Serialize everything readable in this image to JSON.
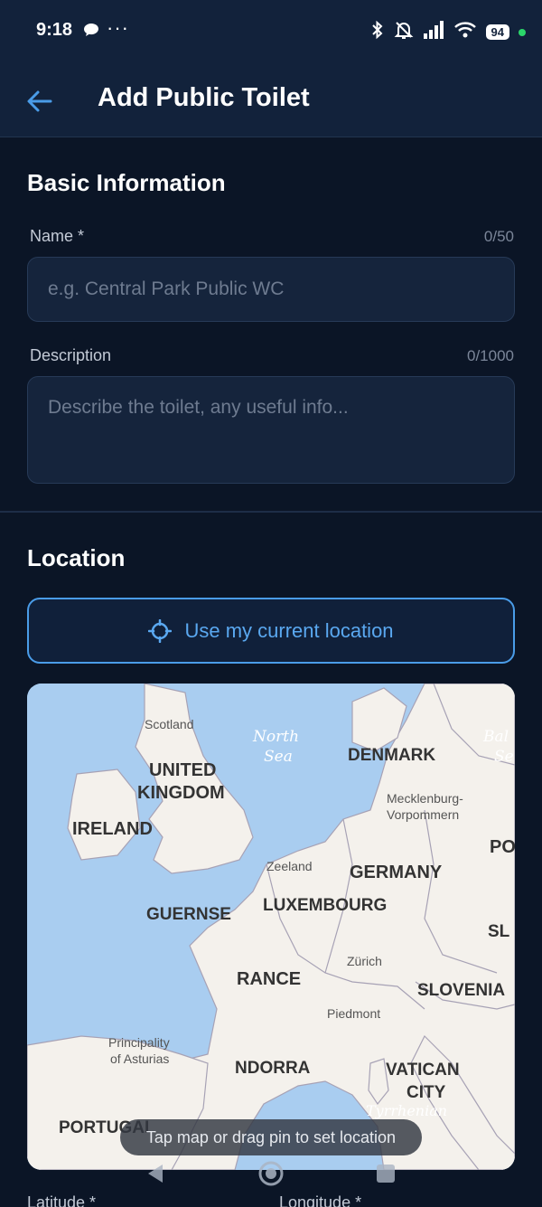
{
  "status": {
    "time": "9:18",
    "dots": "···",
    "battery": "94",
    "colors": {
      "active_dot": "#2bd66a"
    }
  },
  "app_bar": {
    "title": "Add Public Toilet",
    "back_icon": "arrow-left-icon"
  },
  "basic_info": {
    "section_title": "Basic Information",
    "name": {
      "label": "Name *",
      "count": "0/50",
      "placeholder": "e.g. Central Park Public WC"
    },
    "description": {
      "label": "Description",
      "count": "0/1000",
      "placeholder": "Describe the toilet, any useful info..."
    }
  },
  "location": {
    "section_title": "Location",
    "current_location_button": "Use my current location",
    "map_hint": "Tap map or drag pin to set location",
    "map_labels": {
      "scotland": "Scotland",
      "north_sea": "North",
      "north_sea_2": "Sea",
      "denmark": "DENMARK",
      "baltic": "Bal",
      "baltic_2": "Se",
      "united": "UNITED",
      "kingdom": "KINGDOM",
      "mecklenburg": "Mecklenburg-",
      "vorpommern": "Vorpommern",
      "ireland": "IRELAND",
      "poland": "PO",
      "zeeland": "Zeeland",
      "germany": "GERMANY",
      "guernsey": "GUERNSE",
      "luxembourg": "LUXEMBOURG",
      "slovakia": "SL",
      "zurich": "Zürich",
      "france": "RANCE",
      "slovenia": "SLOVENIA",
      "piedmont": "Piedmont",
      "principality": "Principality",
      "of_asturias": "of Asturias",
      "andorra": "NDORRA",
      "vatican": "VATICAN",
      "city": "CITY",
      "portugal": "PORTUGAL",
      "tyrrhenian": "Tyrrhenian"
    },
    "latitude_label": "Latitude *",
    "longitude_label": "Longitude *"
  },
  "colors": {
    "background": "#0b1526",
    "app_bar": "#12223b",
    "accent": "#4a9ce8",
    "input_bg": "#15243c",
    "map_water": "#a9cdf0",
    "map_land": "#f4f1ec"
  }
}
